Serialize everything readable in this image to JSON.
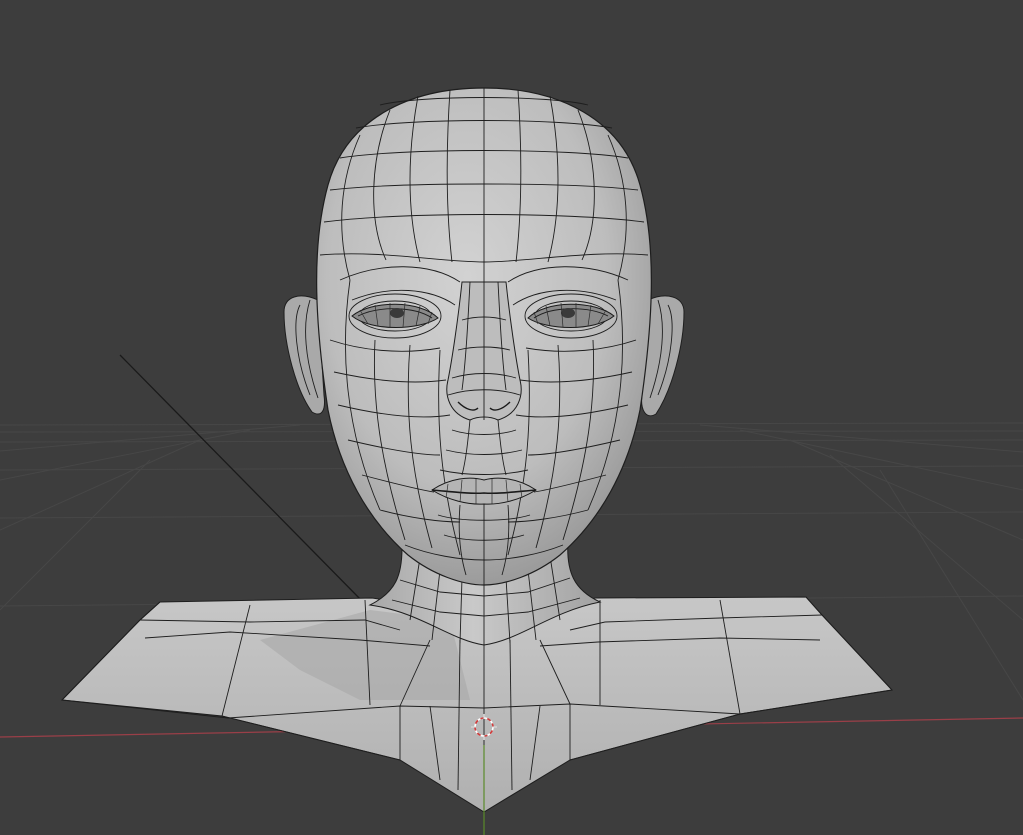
{
  "viewport": {
    "background_color": "#3d3d3d",
    "grid_color": "#4a4a4a",
    "x_axis_color": "#9a3f48",
    "y_axis_color": "#5a8a2a",
    "object_line_color": "#1a1a1a"
  },
  "object": {
    "name_icon": "head-bust-mesh",
    "shading": "solid",
    "overlay": "wireframe",
    "surface_color": "#c4c4c4",
    "wire_color": "#1e1e1e"
  },
  "cursor_3d": {
    "icon": "3d-cursor-icon",
    "ring_colors": [
      "#d23c3c",
      "#ffffff"
    ]
  }
}
